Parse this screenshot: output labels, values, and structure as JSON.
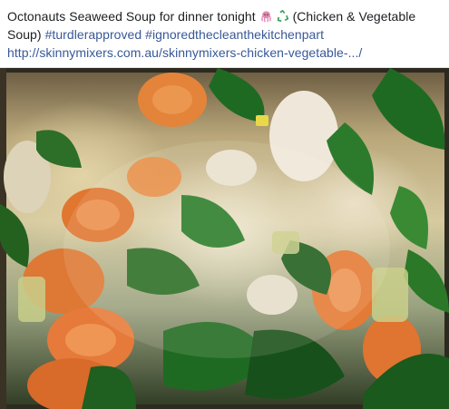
{
  "post": {
    "caption_text": "Octonauts Seaweed Soup for dinner tonight ",
    "caption_after_emoji": " (Chicken & Vegetable Soup) ",
    "hashtag_1": "#turdlerapproved",
    "hashtag_2": "#ignoredthecleanthekitchenpart",
    "link_text": "http://skinnymixers.com.au/skinnymixers-chicken-vegetable-.../",
    "emoji_1": "octopus-emoji",
    "emoji_2": "recycle-seaweed-emoji",
    "photo": "soup-photo"
  },
  "colors": {
    "link": "#385898",
    "text": "#1c1e21"
  }
}
